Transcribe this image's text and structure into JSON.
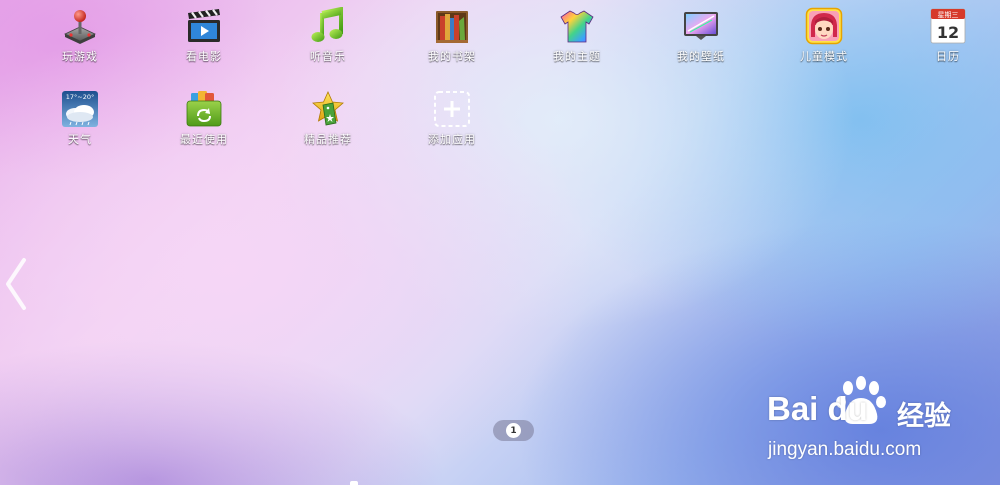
{
  "apps_row1": [
    {
      "label": "玩游戏",
      "icon": "joystick-icon"
    },
    {
      "label": "看电影",
      "icon": "clapperboard-icon"
    },
    {
      "label": "听音乐",
      "icon": "music-note-icon"
    },
    {
      "label": "我的书架",
      "icon": "bookshelf-icon"
    },
    {
      "label": "我的主题",
      "icon": "tshirt-icon"
    },
    {
      "label": "我的壁纸",
      "icon": "wallpaper-icon"
    },
    {
      "label": "儿童模式",
      "icon": "child-face-icon"
    },
    {
      "label": "日历",
      "icon": "calendar-icon"
    }
  ],
  "apps_row2": [
    {
      "label": "天气",
      "icon": "weather-icon"
    },
    {
      "label": "最近使用",
      "icon": "recent-box-icon"
    },
    {
      "label": "精品推荐",
      "icon": "star-tag-icon"
    },
    {
      "label": "添加应用",
      "icon": "add-app-icon"
    }
  ],
  "calendar": {
    "weekday": "星期三",
    "day": "12"
  },
  "weather": {
    "temp": "17°~20°"
  },
  "pager": {
    "current": "1"
  },
  "navigation": {
    "left_arrow_icon": "chevron-left-icon"
  },
  "watermark": {
    "brand": "Bai  du",
    "cn": "经验",
    "url": "jingyan.baidu.com"
  }
}
